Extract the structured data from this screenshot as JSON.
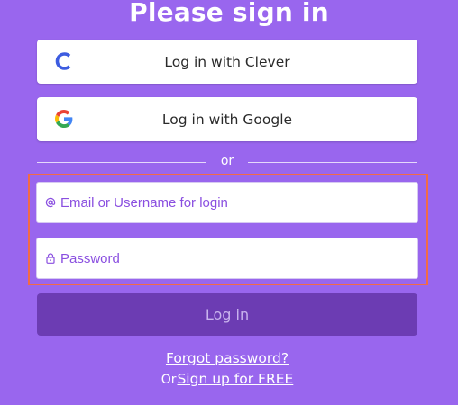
{
  "title": "Please sign in",
  "sso": {
    "clever_label": "Log in with Clever",
    "google_label": "Log in with Google"
  },
  "divider_text": "or",
  "form": {
    "email_placeholder": "Email or Username for login",
    "email_value": "",
    "password_placeholder": "Password",
    "password_value": "",
    "login_label": "Log in"
  },
  "links": {
    "forgot_password": "Forgot password?",
    "signup_prefix": "Or",
    "signup_link": "Sign up for FREE"
  },
  "colors": {
    "background": "#9966ee",
    "login_button": "#6c3cb3",
    "highlight_border": "#f26b45",
    "clever_blue": "#3d5ce0"
  },
  "icons": {
    "clever": "clever-logo-icon",
    "google": "google-logo-icon",
    "email": "at-sign-icon",
    "password": "lock-icon"
  }
}
